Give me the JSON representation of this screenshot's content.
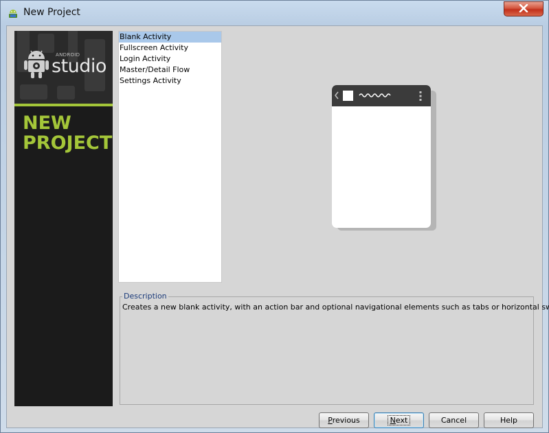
{
  "window": {
    "title": "New Project",
    "close_symbol": "X"
  },
  "side_panel": {
    "brand_small": "ANDROID",
    "brand_large": "studio",
    "heading": "NEW\nPROJECT",
    "accent_color": "#a4c639"
  },
  "templates": {
    "items": [
      {
        "label": "Blank Activity",
        "selected": true
      },
      {
        "label": "Fullscreen Activity",
        "selected": false
      },
      {
        "label": "Login Activity",
        "selected": false
      },
      {
        "label": "Master/Detail Flow",
        "selected": false
      },
      {
        "label": "Settings Activity",
        "selected": false
      }
    ],
    "selection_color": "#a9c8ea"
  },
  "preview": {
    "icons": [
      "back-chevron-icon",
      "app-icon-square",
      "title-squiggle-icon",
      "overflow-menu-icon"
    ]
  },
  "description": {
    "legend": "Description",
    "text": "Creates a new blank activity, with an action bar and optional navigational elements such as tabs or horizontal swipe."
  },
  "buttons": {
    "previous": {
      "label": "Previous",
      "mnemonic": "P"
    },
    "next": {
      "label": "Next",
      "mnemonic": "N"
    },
    "cancel": {
      "label": "Cancel"
    },
    "help": {
      "label": "Help"
    }
  }
}
